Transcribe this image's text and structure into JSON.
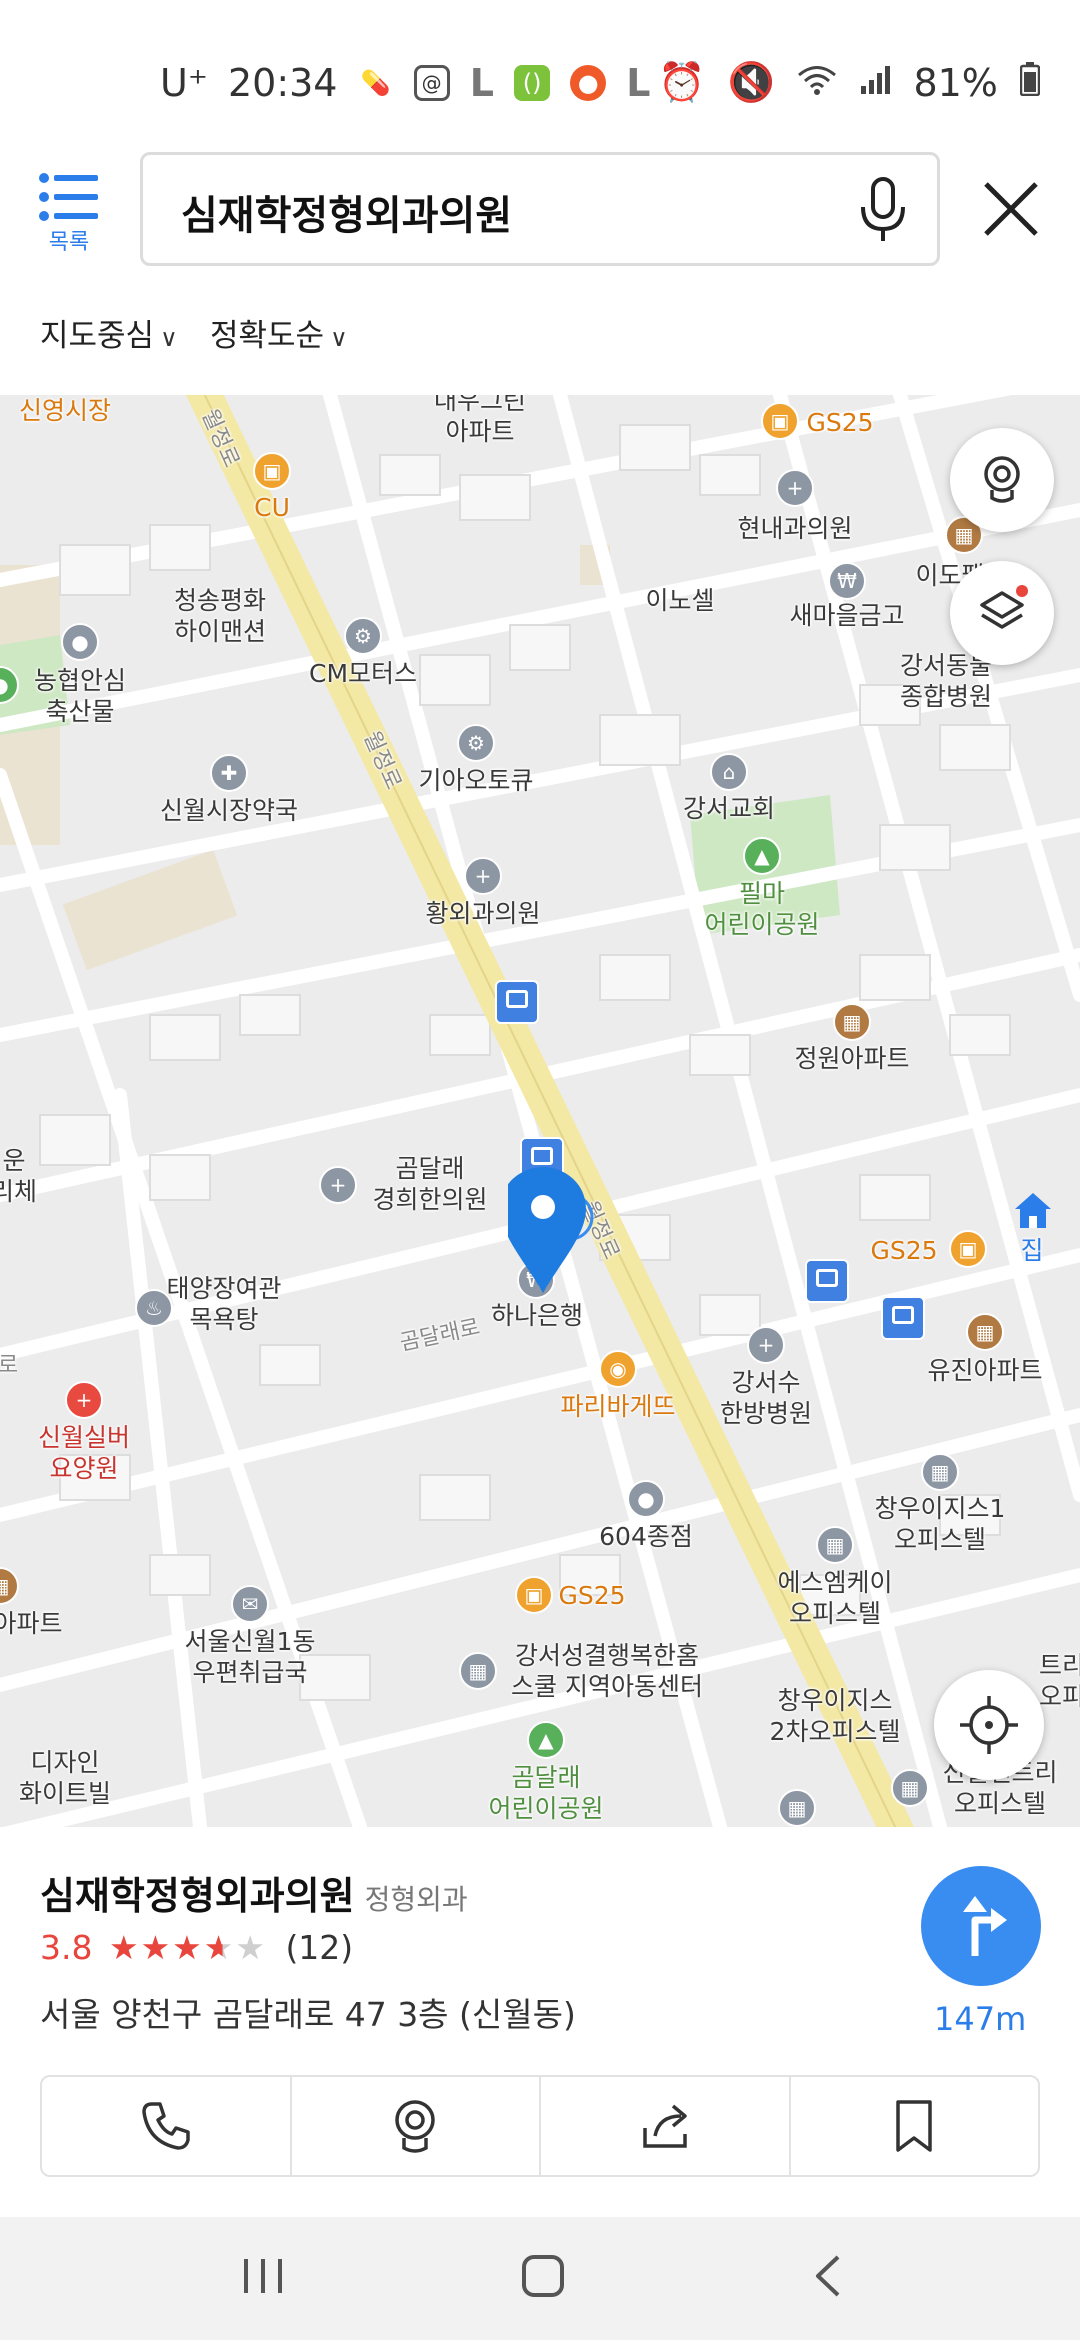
{
  "status_bar": {
    "carrier": "U⁺",
    "time": "20:34",
    "battery": "81%",
    "app_icons": [
      "pill-icon",
      "notification-icon",
      "l-app-icon",
      "green-app-icon",
      "record-icon",
      "l-app-icon",
      "dot-icon"
    ],
    "system_icons": [
      "alarm-icon",
      "mute-icon",
      "wifi-icon",
      "signal-icon",
      "battery-icon"
    ]
  },
  "header": {
    "list_label": "목록",
    "search_value": "심재학정형외과의원",
    "filters": [
      {
        "label": "지도중심"
      },
      {
        "label": "정확도순"
      }
    ]
  },
  "map": {
    "labels": [
      {
        "text": "신영시장",
        "color": "orange"
      },
      {
        "text": "대우그린\n아파트",
        "color": ""
      },
      {
        "text": "GS25",
        "color": "orange"
      },
      {
        "text": "CU",
        "color": "orange"
      },
      {
        "text": "현내과의원",
        "color": ""
      },
      {
        "text": "이도팰",
        "color": ""
      },
      {
        "text": "청송평화\n하이맨션",
        "color": ""
      },
      {
        "text": "이노셀",
        "color": ""
      },
      {
        "text": "새마을금고",
        "color": ""
      },
      {
        "text": "강서동물\n종합병원",
        "color": ""
      },
      {
        "text": "농협안심\n축산물",
        "color": ""
      },
      {
        "text": "CM모터스",
        "color": ""
      },
      {
        "text": "기아오토큐",
        "color": ""
      },
      {
        "text": "신월시장약국",
        "color": ""
      },
      {
        "text": "강서교회",
        "color": ""
      },
      {
        "text": "필마\n어린이공원",
        "color": "green"
      },
      {
        "text": "황외과의원",
        "color": ""
      },
      {
        "text": "정원아파트",
        "color": ""
      },
      {
        "text": "곰달래\n경희한의원",
        "color": ""
      },
      {
        "text": "운\n리체",
        "color": ""
      },
      {
        "text": "집",
        "color": "blue"
      },
      {
        "text": "GS25",
        "color": "orange"
      },
      {
        "text": "태양장여관\n목욕탕",
        "color": ""
      },
      {
        "text": "하나은행",
        "color": ""
      },
      {
        "text": "유진아파트",
        "color": ""
      },
      {
        "text": "파리바게뜨",
        "color": "orange"
      },
      {
        "text": "강서수\n한방병원",
        "color": ""
      },
      {
        "text": "신월실버\n요양원",
        "color": "red"
      },
      {
        "text": "창우이지스1\n오피스텔",
        "color": ""
      },
      {
        "text": "604종점",
        "color": ""
      },
      {
        "text": "에스엠케이\n오피스텔",
        "color": ""
      },
      {
        "text": "GS25",
        "color": "orange"
      },
      {
        "text": "아파트",
        "color": ""
      },
      {
        "text": "서울신월1동\n우편취급국",
        "color": ""
      },
      {
        "text": "강서성결행복한홈\n스쿨 지역아동센터",
        "color": ""
      },
      {
        "text": "창우이지스\n2차오피스텔",
        "color": ""
      },
      {
        "text": "트리\n오피",
        "color": ""
      },
      {
        "text": "디자인\n화이트빌",
        "color": ""
      },
      {
        "text": "곰달래\n어린이공원",
        "color": "green"
      },
      {
        "text": "신월센트리\n오피스텔",
        "color": ""
      }
    ],
    "road_labels": [
      "월정로",
      "월정로",
      "월정로",
      "곰달래로",
      "로"
    ]
  },
  "place": {
    "name": "심재학정형외과의원",
    "category": "정형외과",
    "rating": "3.8",
    "rating_value": 3.8,
    "review_count": "(12)",
    "address": "서울 양천구 곰달래로 47 3층 (신월동)",
    "distance": "147m"
  },
  "colors": {
    "accent": "#3a8df0",
    "rating": "#e8453c",
    "road_main": "#f3e8a4",
    "park": "#cfe8c4"
  }
}
